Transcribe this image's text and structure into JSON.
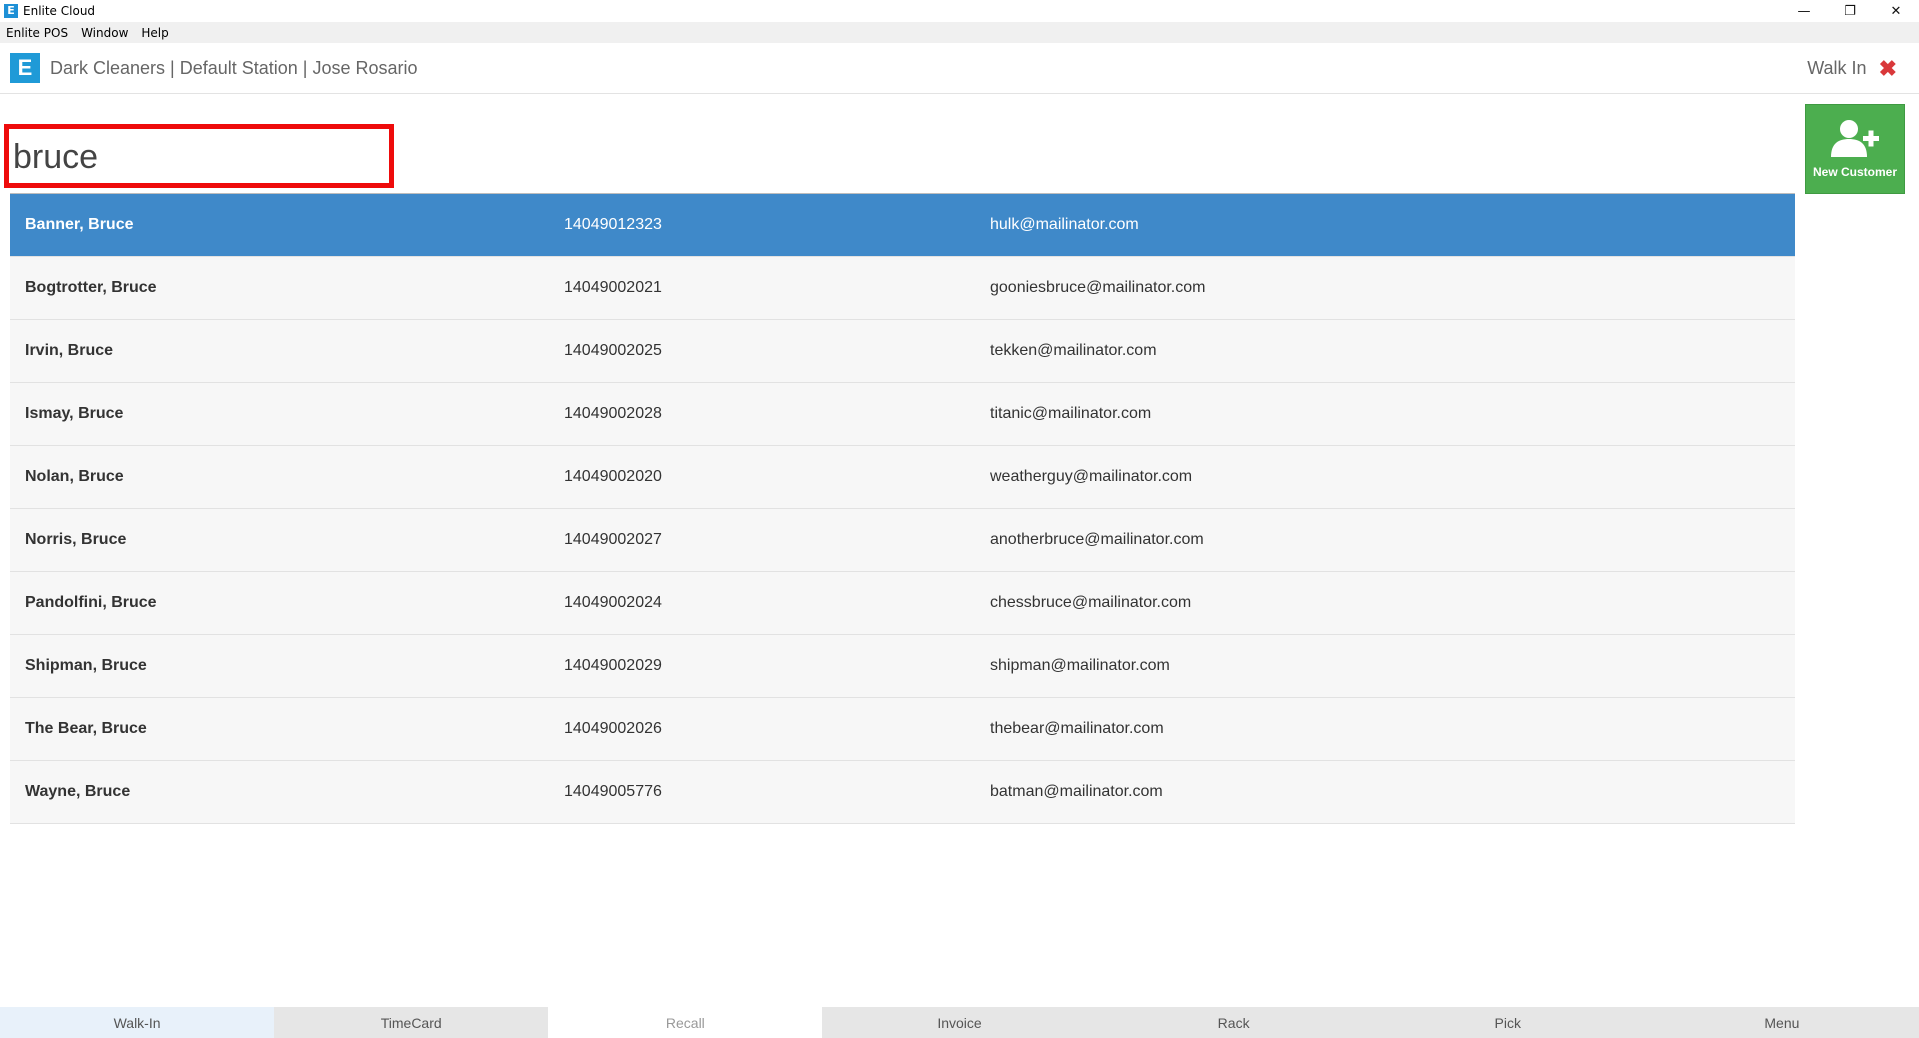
{
  "window": {
    "title": "Enlite Cloud",
    "app_icon": "E",
    "controls": [
      "—",
      "❐",
      "✕"
    ]
  },
  "menubar": [
    "Enlite POS",
    "Window",
    "Help"
  ],
  "header": {
    "logo": "E",
    "context": "Dark Cleaners | Default Station | Jose Rosario",
    "mode_label": "Walk In",
    "close_symbol": "✖"
  },
  "search": {
    "value": "bruce"
  },
  "new_customer": {
    "label": "New Customer"
  },
  "customers": [
    {
      "name": "Banner, Bruce",
      "phone": "14049012323",
      "email": "hulk@mailinator.com",
      "selected": true
    },
    {
      "name": "Bogtrotter, Bruce",
      "phone": "14049002021",
      "email": "gooniesbruce@mailinator.com"
    },
    {
      "name": "Irvin, Bruce",
      "phone": "14049002025",
      "email": "tekken@mailinator.com"
    },
    {
      "name": "Ismay, Bruce",
      "phone": "14049002028",
      "email": "titanic@mailinator.com"
    },
    {
      "name": "Nolan, Bruce",
      "phone": "14049002020",
      "email": "weatherguy@mailinator.com"
    },
    {
      "name": "Norris, Bruce",
      "phone": "14049002027",
      "email": "anotherbruce@mailinator.com"
    },
    {
      "name": "Pandolfini, Bruce",
      "phone": "14049002024",
      "email": "chessbruce@mailinator.com"
    },
    {
      "name": "Shipman, Bruce",
      "phone": "14049002029",
      "email": "shipman@mailinator.com"
    },
    {
      "name": "The Bear, Bruce",
      "phone": "14049002026",
      "email": "thebear@mailinator.com"
    },
    {
      "name": "Wayne, Bruce",
      "phone": "14049005776",
      "email": "batman@mailinator.com"
    }
  ],
  "tabs": [
    {
      "label": "Walk-In"
    },
    {
      "label": "TimeCard"
    },
    {
      "label": "Recall",
      "active": true
    },
    {
      "label": "Invoice"
    },
    {
      "label": "Rack"
    },
    {
      "label": "Pick"
    },
    {
      "label": "Menu"
    }
  ],
  "colors": {
    "brand": "#1f9ad7",
    "selected_row": "#3f89c9",
    "new_customer": "#4cae4f",
    "highlight_box": "#ee0b0b",
    "close": "#d9383a"
  },
  "icons": {
    "app": "enlite-logo-icon",
    "new_customer": "add-user-icon",
    "close": "close-icon"
  }
}
